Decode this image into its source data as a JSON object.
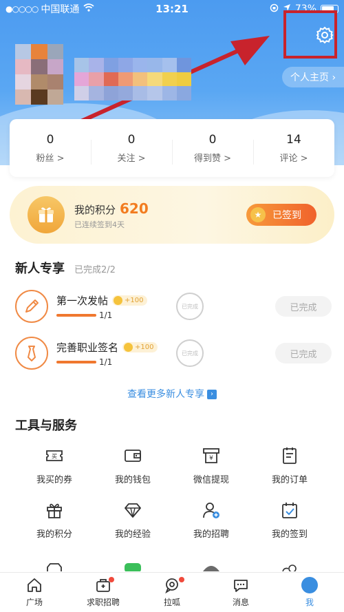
{
  "status_bar": {
    "signal": "●○○○○",
    "carrier": "中国联通",
    "time": "13:21",
    "battery_text": "73%"
  },
  "profile": {
    "homepage_label": "个人主页 ›"
  },
  "stats": [
    {
      "value": "0",
      "label": "粉丝 >"
    },
    {
      "value": "0",
      "label": "关注 >"
    },
    {
      "value": "0",
      "label": "得到赞 >"
    },
    {
      "value": "14",
      "label": "评论 >"
    }
  ],
  "points": {
    "label": "我的积分",
    "value": "620",
    "sub": "已连续签到4天",
    "signed_label": "已签到"
  },
  "newbie": {
    "title": "新人专享",
    "progress": "已完成2/2",
    "tasks": [
      {
        "name": "第一次发帖",
        "reward": "+100",
        "progress": "1/1",
        "stamp": "已完成",
        "status": "已完成"
      },
      {
        "name": "完善职业签名",
        "reward": "+100",
        "progress": "1/1",
        "stamp": "已完成",
        "status": "已完成"
      }
    ],
    "more_label": "查看更多新人专享"
  },
  "tools": {
    "title": "工具与服务",
    "items": [
      {
        "label": "我买的券",
        "icon": "ticket-icon"
      },
      {
        "label": "我的钱包",
        "icon": "wallet-icon"
      },
      {
        "label": "微信提现",
        "icon": "withdraw-icon"
      },
      {
        "label": "我的订单",
        "icon": "order-icon"
      },
      {
        "label": "我的积分",
        "icon": "gift-icon"
      },
      {
        "label": "我的经验",
        "icon": "diamond-icon"
      },
      {
        "label": "我的招聘",
        "icon": "user-add-icon"
      },
      {
        "label": "我的签到",
        "icon": "calendar-check-icon"
      }
    ]
  },
  "tabs": [
    {
      "label": "广场",
      "icon": "home-icon",
      "dot": false
    },
    {
      "label": "求职招聘",
      "icon": "briefcase-icon",
      "dot": true
    },
    {
      "label": "拉呱",
      "icon": "chat-circle-icon",
      "dot": true
    },
    {
      "label": "消息",
      "icon": "message-icon",
      "dot": false
    },
    {
      "label": "我",
      "icon": "me-icon",
      "dot": false
    }
  ],
  "colors": {
    "accent": "#3a8ee0",
    "orange": "#f27c20",
    "highlight_box": "#c8232c"
  }
}
